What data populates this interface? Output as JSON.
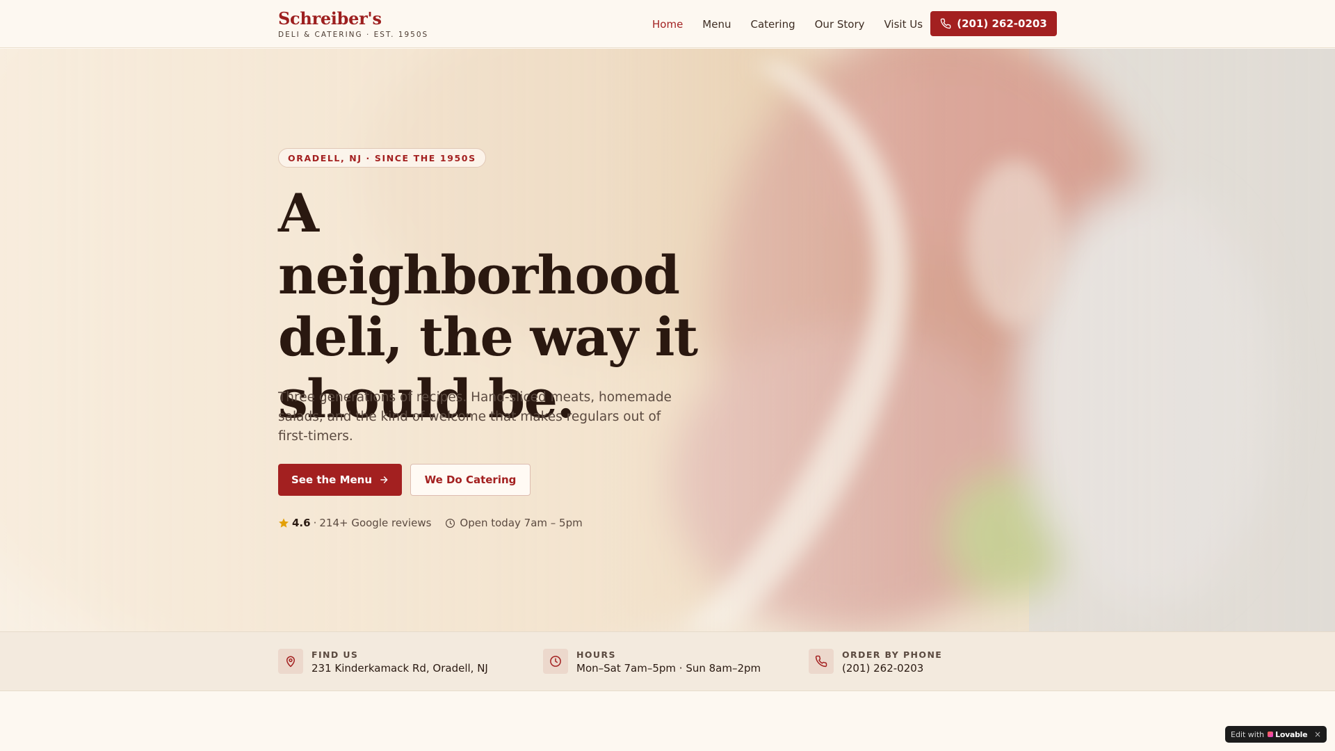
{
  "header": {
    "brand_name": "Schreiber's",
    "brand_tagline": "DELI & CATERING · EST. 1950S",
    "nav": [
      {
        "label": "Home",
        "active": true
      },
      {
        "label": "Menu",
        "active": false
      },
      {
        "label": "Catering",
        "active": false
      },
      {
        "label": "Our Story",
        "active": false
      },
      {
        "label": "Visit Us",
        "active": false
      }
    ],
    "phone_button": "(201) 262-0203"
  },
  "hero": {
    "badge": "ORADELL, NJ · SINCE THE 1950S",
    "headline_lines": [
      "A neighborhood",
      "deli, the way it",
      "should be."
    ],
    "subtext": "Three generations of recipes. Hand-sliced meats, homemade salads, and the kind of welcome that makes regulars out of first-timers.",
    "primary_cta": "See the Menu",
    "secondary_cta": "We Do Catering",
    "rating": "4.6",
    "reviews": "214+ Google reviews",
    "open_today": "Open today 7am – 5pm"
  },
  "info_bar": [
    {
      "label": "FIND US",
      "value": "231 Kinderkamack Rd, Oradell, NJ",
      "icon": "map-pin-icon"
    },
    {
      "label": "HOURS",
      "value": "Mon–Sat 7am–5pm · Sun 8am–2pm",
      "icon": "clock-icon"
    },
    {
      "label": "ORDER BY PHONE",
      "value": "(201) 262-0203",
      "icon": "phone-icon"
    }
  ],
  "lovable_badge": {
    "prefix": "Edit with",
    "brand": "Lovable",
    "close": "×"
  },
  "colors": {
    "accent": "#a32020",
    "background": "#fdf8f1",
    "text_dark": "#2a1810",
    "star": "#e3a008"
  }
}
